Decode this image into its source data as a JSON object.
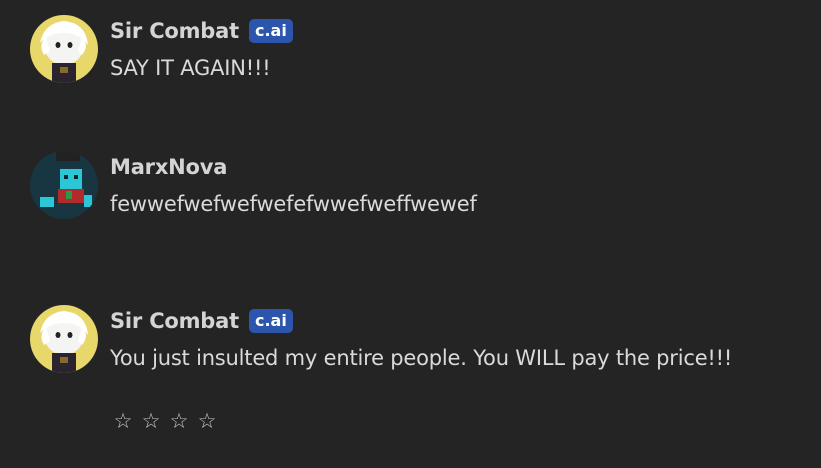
{
  "messages": [
    {
      "author": "Sir Combat",
      "badge": "c.ai",
      "text": "SAY IT AGAIN!!!",
      "avatar_icon": "character-avatar-icon"
    },
    {
      "author": "MarxNova",
      "text": "fewwefwefwefwefefwwefweffwewef",
      "avatar_icon": "user-avatar-icon"
    },
    {
      "author": "Sir Combat",
      "badge": "c.ai",
      "text": "You just insulted my entire people. You WILL pay the price!!!",
      "avatar_icon": "character-avatar-icon"
    }
  ],
  "rating": {
    "stars": [
      "☆",
      "☆",
      "☆",
      "☆"
    ],
    "filled": 0,
    "max": 4,
    "icon": "star-icon"
  },
  "colors": {
    "background": "#242424",
    "badge": "#2c55ad",
    "text": "#dadada"
  }
}
